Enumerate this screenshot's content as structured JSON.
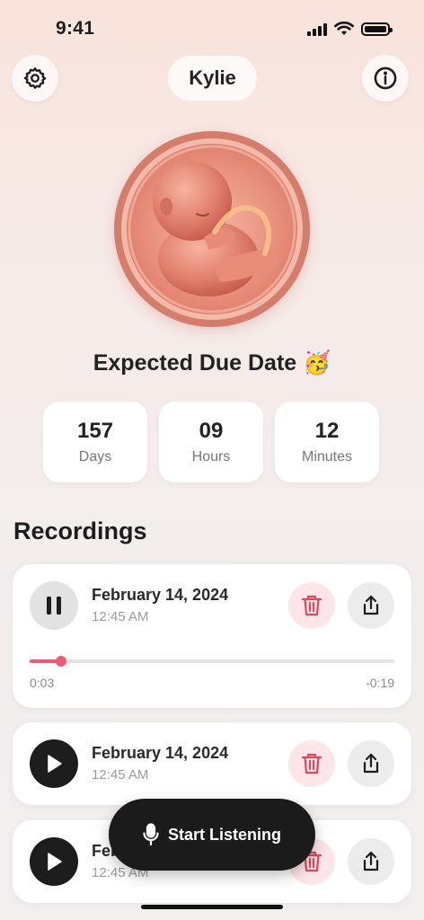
{
  "status_bar": {
    "time": "9:41",
    "icons": [
      "signal-icon",
      "wifi-icon",
      "battery-icon"
    ]
  },
  "header": {
    "name": "Kylie",
    "left_icon": "gear-icon",
    "right_icon": "info-icon"
  },
  "due_date": {
    "title": "Expected Due Date 🥳",
    "countdown": [
      {
        "value": "157",
        "unit": "Days"
      },
      {
        "value": "09",
        "unit": "Hours"
      },
      {
        "value": "12",
        "unit": "Minutes"
      }
    ]
  },
  "recordings": {
    "title": "Recordings",
    "items": [
      {
        "date": "February 14, 2024",
        "time": "12:45 AM",
        "state": "playing",
        "elapsed": "0:03",
        "remaining": "-0:19",
        "progress": 0.085
      },
      {
        "date": "February 14, 2024",
        "time": "12:45 AM",
        "state": "paused"
      },
      {
        "date": "February 14, 2024",
        "time": "12:45 AM",
        "state": "paused"
      }
    ]
  },
  "listen_button": {
    "label": "Start Listening",
    "icon": "microphone-icon"
  },
  "colors": {
    "accent": "#ef5b77",
    "delete_bg": "#fde6e8",
    "delete_icon": "#e0485c",
    "dark": "#1b1b1b"
  }
}
